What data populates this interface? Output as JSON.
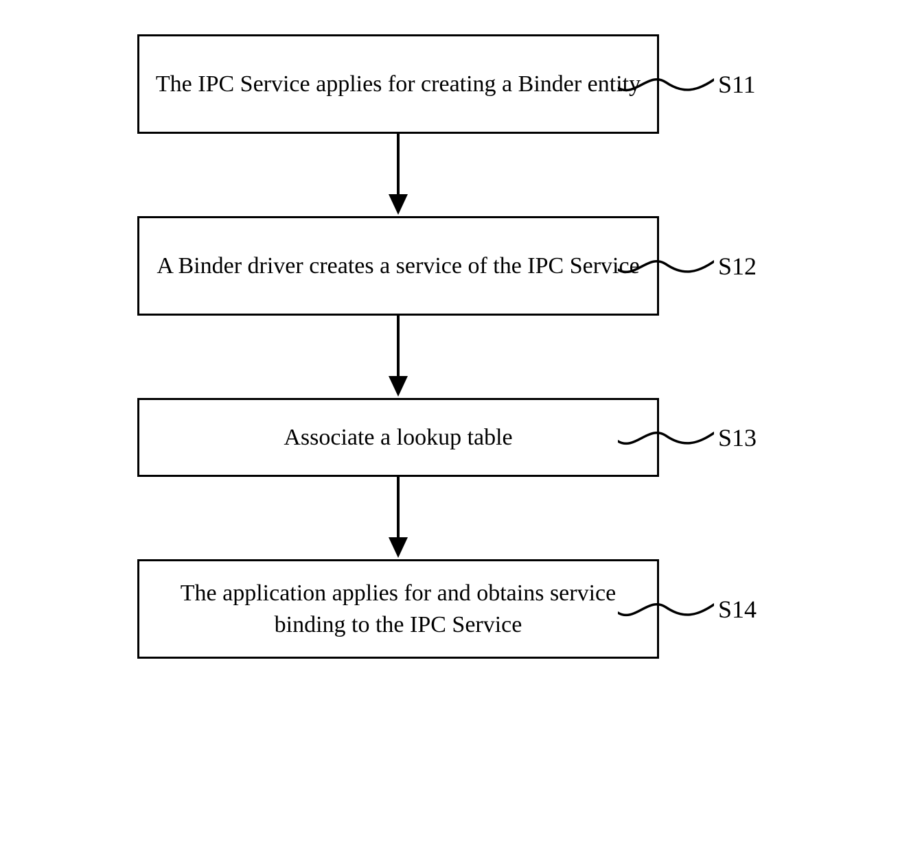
{
  "steps": [
    {
      "label": "S11",
      "text": "The IPC Service applies for creating a Binder entity"
    },
    {
      "label": "S12",
      "text": "A Binder driver creates a service of the IPC Service"
    },
    {
      "label": "S13",
      "text": "Associate a lookup table"
    },
    {
      "label": "S14",
      "text": "The application applies for and obtains service binding to the IPC Service"
    }
  ]
}
